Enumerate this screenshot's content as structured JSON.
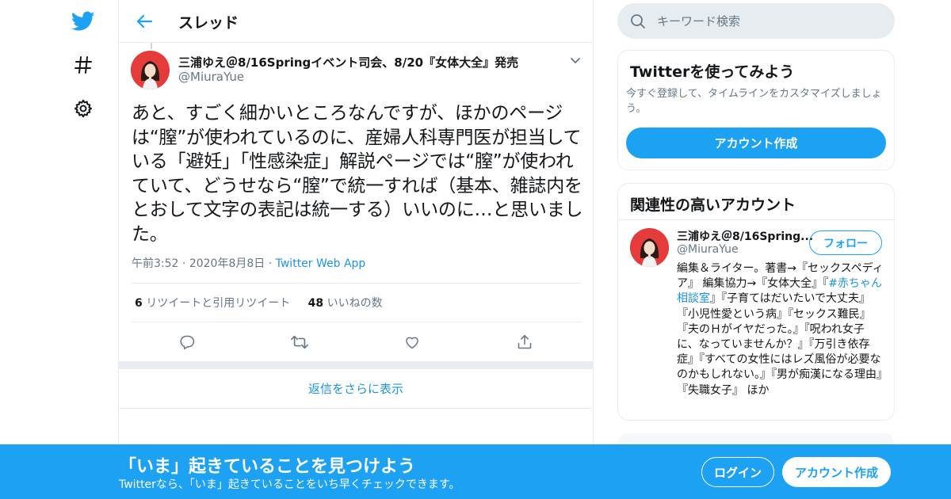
{
  "colors": {
    "accent": "#1da1f2",
    "link": "#1b95e0",
    "secondary_text": "#657786",
    "border": "#e6ecf0",
    "avatar_bg": "#e53b3b"
  },
  "nav": {
    "icons": [
      "twitter-bird-icon",
      "hashtag-icon",
      "gear-icon"
    ]
  },
  "header": {
    "title": "スレッド"
  },
  "tweet": {
    "author_name": "三浦ゆえ＠8/16Springイベント司会、8/20『女体大全』発売",
    "author_handle": "@MiuraYue",
    "text": "あと、すごく細かいところなんですが、ほかのページは“膣”が使われているのに、産婦人科専門医が担当している「避妊」「性感染症」解説ページでは“膣”が使われていて、どうせなら“膣”で統一すれば（基本、雑誌内をとおして文字の表記は統一する）いいのに…と思いました。",
    "time": "午前3:52",
    "date": "2020年8月8日",
    "source": "Twitter Web App",
    "retweets_count": "6",
    "retweets_label": "リツイートと引用リツイート",
    "likes_count": "48",
    "likes_label": "いいねの数"
  },
  "more_replies": "返信をさらに表示",
  "search": {
    "placeholder": "キーワード検索"
  },
  "signup_card": {
    "title": "Twitterを使ってみよう",
    "subtitle": "今すぐ登録して、タイムラインをカスタマイズしましょう。",
    "button": "アカウント作成"
  },
  "related": {
    "title": "関連性の高いアカウント",
    "name": "三浦ゆえ＠8/16Spring...",
    "handle": "@MiuraYue",
    "follow": "フォロー",
    "bio_pre": "編集＆ライター。著書→『セックスペディア』 編集協力→『女体大全』『",
    "bio_link": "#赤ちゃん相談室",
    "bio_post": "』『子育てはだいたいで大丈夫』『小児性愛という病』『セックス難民』『夫のＨがイヤだった。』『呪われ女子に、なっていませんか？』『万引き依存症』『すべての女性にはレズ風俗が必要なのかもしれない。』『男が痴漢になる理由』『失職女子』 ほか"
  },
  "bottom_bar": {
    "title": "「いま」起きていることを見つけよう",
    "subtitle": "Twitterなら、「いま」起きていることをいち早くチェックできます。",
    "login": "ログイン",
    "signup": "アカウント作成"
  }
}
